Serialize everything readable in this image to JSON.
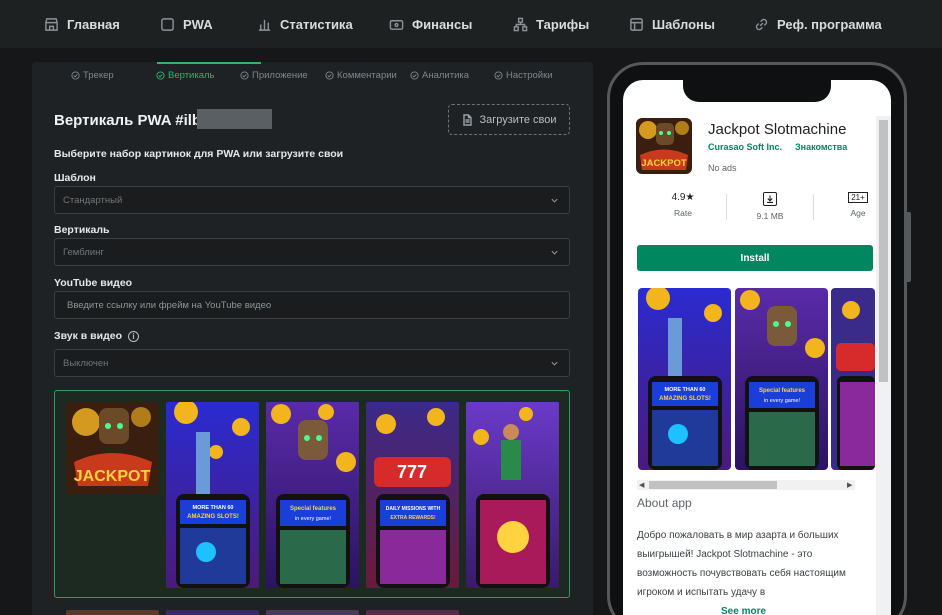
{
  "nav": {
    "items": [
      {
        "label": "Главная",
        "icon": "store-icon"
      },
      {
        "label": "PWA",
        "icon": "square-icon"
      },
      {
        "label": "Статистика",
        "icon": "bar-chart-icon"
      },
      {
        "label": "Финансы",
        "icon": "wallet-icon"
      },
      {
        "label": "Тарифы",
        "icon": "network-icon"
      },
      {
        "label": "Шаблоны",
        "icon": "layout-icon"
      },
      {
        "label": "Реф. программа",
        "icon": "link-icon"
      }
    ]
  },
  "steps": [
    {
      "label": "Трекер",
      "active": false
    },
    {
      "label": "Вертикаль",
      "active": true
    },
    {
      "label": "Приложение",
      "active": false
    },
    {
      "label": "Комментарии",
      "active": false
    },
    {
      "label": "Аналитика",
      "active": false
    },
    {
      "label": "Настройки",
      "active": false
    }
  ],
  "form": {
    "title": "Вертикаль PWA #ilb",
    "upload_label": "Загрузите свои",
    "subtitle": "Выберите набор картинок для PWA или загрузите свои",
    "template_label": "Шаблон",
    "template_value": "Стандартный",
    "vertical_label": "Вертикаль",
    "vertical_value": "Гемблинг",
    "youtube_label": "YouTube видео",
    "youtube_placeholder": "Введите ссылку или фрейм на YouTube видео",
    "sound_label": "Звук в видео",
    "sound_value": "Выключен"
  },
  "preview": {
    "app_name": "Jackpot Slotmachine",
    "developer": "Curasao Soft Inc.",
    "category": "Знакомства",
    "ads": "No ads",
    "rating": "4.9★",
    "rating_label": "Rate",
    "size": "9.1 MB",
    "age": "21+",
    "age_label": "Age",
    "install_label": "Install",
    "about_label": "About app",
    "description": "Добро пожаловать в мир азарта и больших выигрышей! Jackpot Slotmachine - это возможность почувствовать себя настоящим игроком и испытать удачу в",
    "see_more": "See more",
    "icon_text": "JACKPOT",
    "shot_banners": [
      "MORE THAN 60 AMAZING SLOTS!",
      "Special features in every game!",
      "DAILY MISSIONS WITH EXTRA REWARDS!"
    ]
  },
  "colors": {
    "accent": "#33b36b",
    "install": "#01875f",
    "background": "#151718",
    "panel": "#1f2224"
  }
}
